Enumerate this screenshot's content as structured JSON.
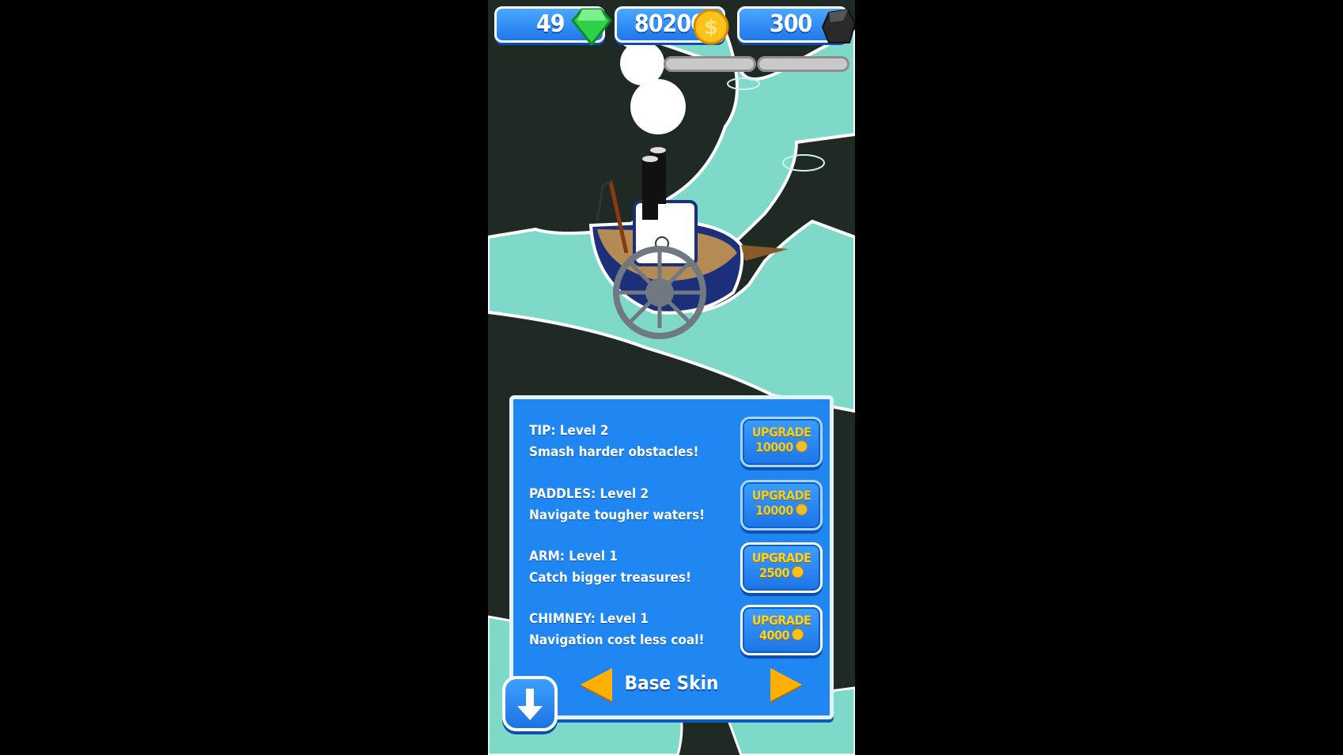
{
  "hud": {
    "gems": "49",
    "coins": "80200",
    "coal": "300"
  },
  "upgrades": [
    {
      "line1": "TIP: Level 2",
      "line2": "Smash harder obstacles!",
      "label": "UPGRADE",
      "price": "10000"
    },
    {
      "line1": "PADDLES: Level 2",
      "line2": "Navigate tougher waters!",
      "label": "UPGRADE",
      "price": "10000"
    },
    {
      "line1": "ARM: Level 1",
      "line2": "Catch bigger treasures!",
      "label": "UPGRADE",
      "price": "2500"
    },
    {
      "line1": "CHIMNEY: Level 1",
      "line2": "Navigation cost less coal!",
      "label": "UPGRADE",
      "price": "4000"
    }
  ],
  "skin_name": "Base Skin",
  "icons": {
    "gem": "green-gem-icon",
    "coin": "gold-coin-icon",
    "coal": "coal-icon",
    "down": "down-arrow-icon",
    "prev": "left-arrow-icon",
    "next": "right-arrow-icon"
  },
  "colors": {
    "panel": "#1f86f2",
    "button_text": "#ffd21a",
    "water": "#7fd9c9",
    "land": "#1f2a24"
  }
}
